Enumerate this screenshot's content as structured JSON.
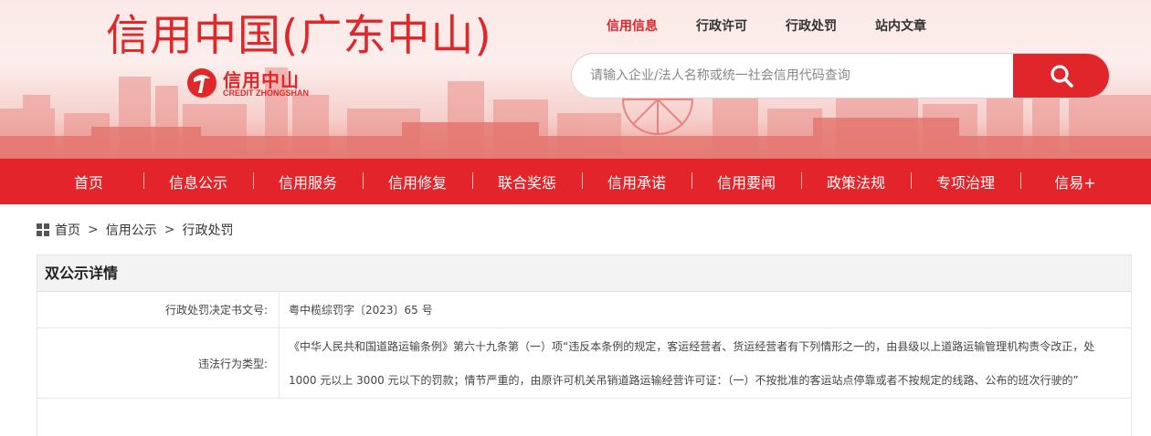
{
  "header": {
    "site_title": "信用中国(广东中山)",
    "logo_cn": "信用中山",
    "logo_en": "CREDIT ZHONGSHAN"
  },
  "top_links": [
    {
      "label": "信用信息",
      "active": true
    },
    {
      "label": "行政许可",
      "active": false
    },
    {
      "label": "行政处罚",
      "active": false
    },
    {
      "label": "站内文章",
      "active": false
    }
  ],
  "search": {
    "placeholder": "请输入企业/法人名称或统一社会信用代码查询",
    "value": "",
    "button_icon": "search-icon"
  },
  "nav": {
    "items": [
      "首页",
      "信息公示",
      "信用服务",
      "信用修复",
      "联合奖惩",
      "信用承诺",
      "信用要闻",
      "政策法规",
      "专项治理",
      "信易+"
    ]
  },
  "breadcrumb": {
    "icon": "grid-icon",
    "items": [
      "首页",
      "信用公示",
      "行政处罚"
    ],
    "separator": ">"
  },
  "detail": {
    "title": "双公示详情",
    "rows": [
      {
        "label": "行政处罚决定书文号:",
        "value": "粤中榄综罚字〔2023〕65 号"
      },
      {
        "label": "违法行为类型:",
        "value": "《中华人民共和国道路运输条例》第六十九条第（一）项“违反本条例的规定，客运经营者、货运经营者有下列情形之一的，由县级以上道路运输管理机构责令改正，处1000 元以上 3000 元以下的罚款；情节严重的，由原许可机关吊销道路运输经营许可证：（一）不按批准的客运站点停靠或者不按规定的线路、公布的班次行驶的”"
      }
    ]
  },
  "colors": {
    "brand_red": "#e3242b",
    "active_link": "#d9252a",
    "panel_head_bg": "#f3f3f3"
  }
}
